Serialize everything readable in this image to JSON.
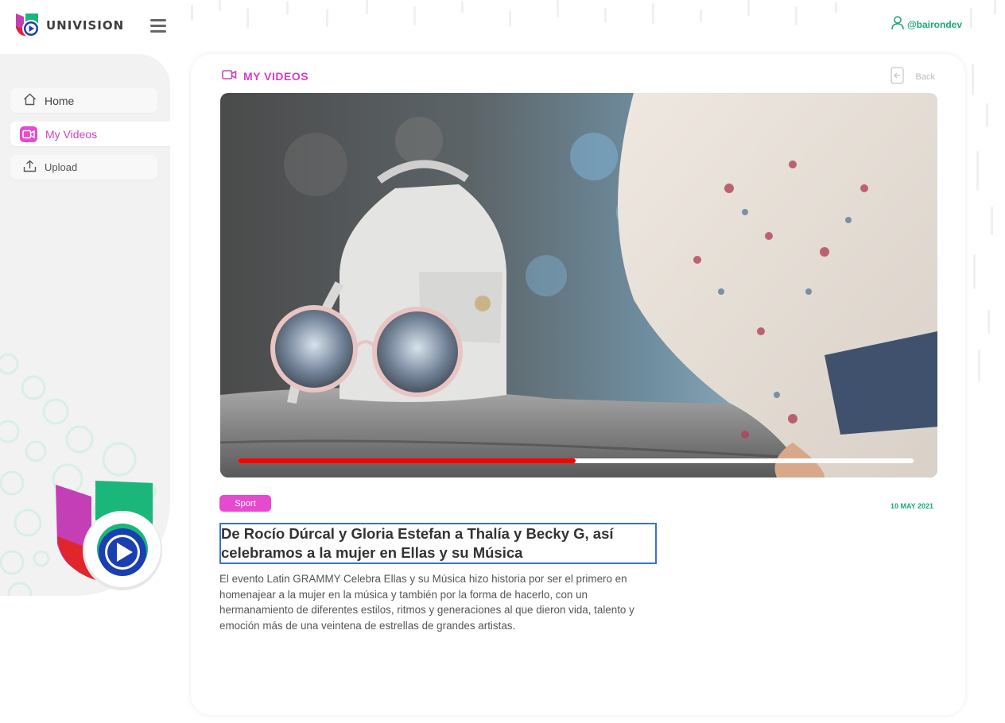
{
  "header": {
    "brand": "UNIVISION",
    "user_handle": "@bairondev"
  },
  "sidebar": {
    "items": [
      {
        "label": "Home",
        "icon": "home-icon"
      },
      {
        "label": "My Videos",
        "icon": "video-camera-icon",
        "active": true
      },
      {
        "label": "Upload",
        "icon": "upload-icon"
      }
    ]
  },
  "main": {
    "section_title": "MY VIDEOS",
    "back_label": "Back",
    "video": {
      "progress_percent": 50
    },
    "tag": "Sport",
    "date": "10 MAY 2021",
    "headline": "De Rocío Dúrcal y Gloria Estefan a Thalía y Becky G, así celebramos a la mujer en Ellas y su Música",
    "description": "El evento Latin GRAMMY Celebra Ellas y su Música hizo historia por ser el primero en homenajear a la mujer en la música y también por la forma de hacerlo, con un hermanamiento de diferentes estilos, ritmos y generaciones al que dieron vida, talento y emoción más de una veintena de estrellas de grandes artistas."
  },
  "colors": {
    "accent_pink": "#e64ad0",
    "accent_green": "#1aa87d",
    "progress_red": "#ff0000",
    "headline_border": "#3d6fd1"
  }
}
